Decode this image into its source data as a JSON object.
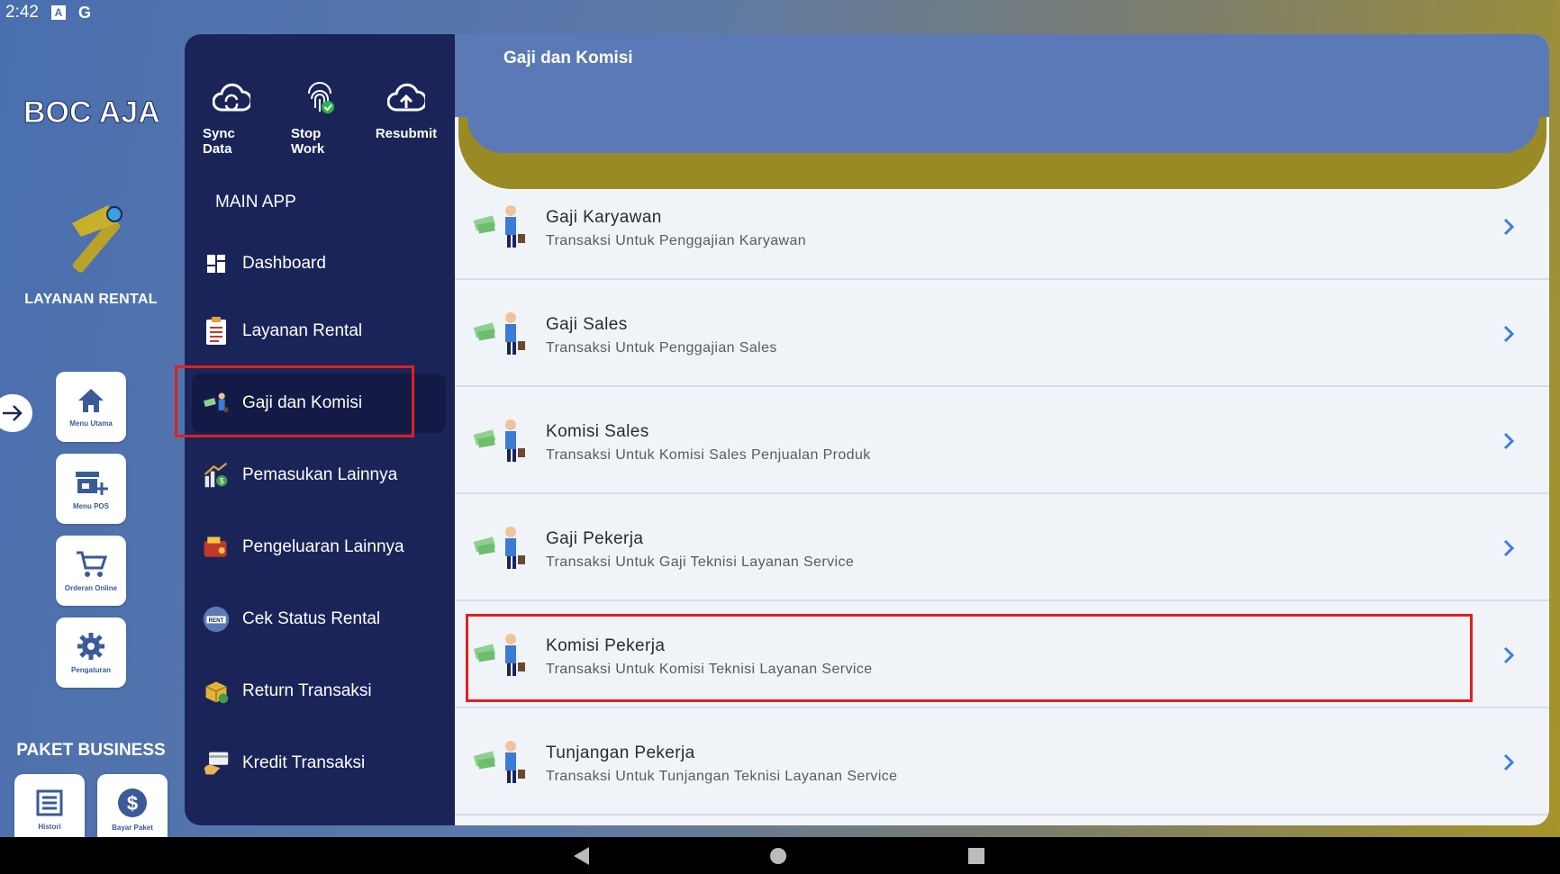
{
  "status_bar": {
    "time": "2:42",
    "a_icon": "A",
    "g_icon": "G"
  },
  "rail": {
    "logo_text": "BOC AJA",
    "brand_label": "LAYANAN RENTAL",
    "buttons": [
      {
        "label": "Menu Utama",
        "icon": "home-icon"
      },
      {
        "label": "Menu POS",
        "icon": "store-add-icon"
      },
      {
        "label": "Orderan Online",
        "icon": "cart-icon"
      },
      {
        "label": "Pengaturan",
        "icon": "gear-icon"
      }
    ],
    "paket_label": "PAKET BUSINESS",
    "paket_buttons": [
      {
        "label": "Histori",
        "icon": "list-icon"
      },
      {
        "label": "Bayar Paket",
        "icon": "dollar-icon"
      }
    ]
  },
  "sidemenu": {
    "quick_actions": [
      {
        "label": "Sync Data",
        "icon": "cloud-sync-icon"
      },
      {
        "label": "Stop Work",
        "icon": "fingerprint-icon"
      },
      {
        "label": "Resubmit",
        "icon": "cloud-upload-icon"
      }
    ],
    "section_title": "MAIN APP",
    "items": [
      {
        "label": "Dashboard",
        "icon": "dashboard-icon"
      },
      {
        "label": "Layanan Rental",
        "icon": "clipboard-icon"
      },
      {
        "label": "Gaji dan Komisi",
        "icon": "salary-icon",
        "active": true
      },
      {
        "label": "Pemasukan Lainnya",
        "icon": "income-icon"
      },
      {
        "label": "Pengeluaran Lainnya",
        "icon": "expense-icon"
      },
      {
        "label": "Cek Status Rental",
        "icon": "rent-status-icon"
      },
      {
        "label": "Return Transaksi",
        "icon": "return-box-icon"
      },
      {
        "label": "Kredit Transaksi",
        "icon": "credit-icon"
      }
    ]
  },
  "main": {
    "title": "Gaji dan Komisi",
    "rows": [
      {
        "title": "Gaji Karyawan",
        "subtitle": "Transaksi Untuk Penggajian Karyawan"
      },
      {
        "title": "Gaji Sales",
        "subtitle": "Transaksi Untuk Penggajian Sales"
      },
      {
        "title": "Komisi Sales",
        "subtitle": "Transaksi Untuk Komisi Sales Penjualan Produk"
      },
      {
        "title": "Gaji Pekerja",
        "subtitle": "Transaksi Untuk Gaji Teknisi Layanan Service"
      },
      {
        "title": "Komisi Pekerja",
        "subtitle": "Transaksi Untuk Komisi Teknisi Layanan Service"
      },
      {
        "title": "Tunjangan Pekerja",
        "subtitle": "Transaksi Untuk Tunjangan Teknisi Layanan Service"
      }
    ]
  },
  "colors": {
    "sidebar_bg": "#1b2459",
    "header_bg": "#5b79b7",
    "accent_gold": "#9a8a25",
    "highlight_red": "#e02020",
    "chevron_blue": "#3b7ddd"
  }
}
